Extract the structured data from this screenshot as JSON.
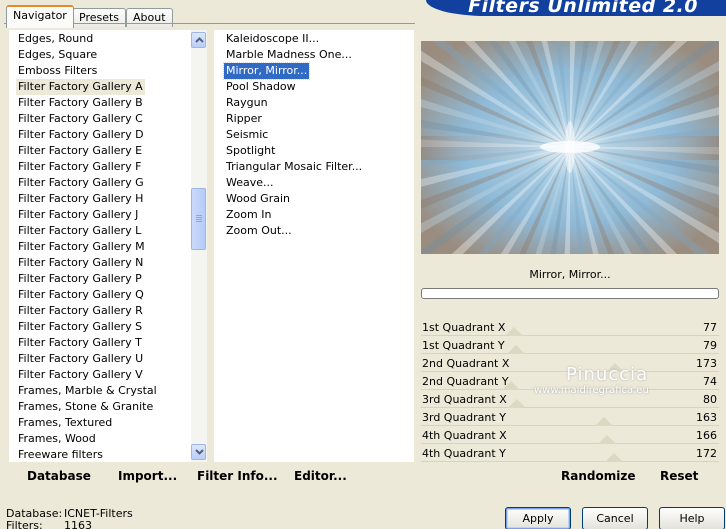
{
  "tabs": [
    {
      "label": "Navigator",
      "active": true
    },
    {
      "label": "Presets",
      "active": false
    },
    {
      "label": "About",
      "active": false
    }
  ],
  "banner_title": "Filters Unlimited 2.0",
  "categories": [
    "Edges, Round",
    "Edges, Square",
    "Emboss Filters",
    "Filter Factory Gallery A",
    "Filter Factory Gallery B",
    "Filter Factory Gallery C",
    "Filter Factory Gallery D",
    "Filter Factory Gallery E",
    "Filter Factory Gallery F",
    "Filter Factory Gallery G",
    "Filter Factory Gallery H",
    "Filter Factory Gallery J",
    "Filter Factory Gallery L",
    "Filter Factory Gallery M",
    "Filter Factory Gallery N",
    "Filter Factory Gallery P",
    "Filter Factory Gallery Q",
    "Filter Factory Gallery R",
    "Filter Factory Gallery S",
    "Filter Factory Gallery T",
    "Filter Factory Gallery U",
    "Filter Factory Gallery V",
    "Frames, Marble & Crystal",
    "Frames, Stone & Granite",
    "Frames, Textured",
    "Frames, Wood",
    "Freeware filters"
  ],
  "selected_category": "Filter Factory Gallery A",
  "filters": [
    "Kaleidoscope II...",
    "Marble Madness One...",
    "Mirror, Mirror...",
    "Pool Shadow",
    "Raygun",
    "Ripper",
    "Seismic",
    "Spotlight",
    "Triangular Mosaic Filter...",
    "Weave...",
    "Wood Grain",
    "Zoom In",
    "Zoom Out..."
  ],
  "selected_filter": "Mirror, Mirror...",
  "toolbar": {
    "database": "Database",
    "import": "Import...",
    "filter_info": "Filter Info...",
    "editor": "Editor..."
  },
  "filter_title": "Mirror, Mirror...",
  "sliders": [
    {
      "label": "1st Quadrant X",
      "value": 77
    },
    {
      "label": "1st Quadrant Y",
      "value": 79
    },
    {
      "label": "2nd Quadrant X",
      "value": 173
    },
    {
      "label": "2nd Quadrant Y",
      "value": 74
    },
    {
      "label": "3rd Quadrant X",
      "value": 80
    },
    {
      "label": "3rd Quadrant Y",
      "value": 163
    },
    {
      "label": "4th Quadrant X",
      "value": 166
    },
    {
      "label": "4th Quadrant Y",
      "value": 172
    }
  ],
  "slider_max": 255,
  "watermark": {
    "name": "Pinuccia",
    "url": "www.maidiregrafica.eu"
  },
  "randomize": "Randomize",
  "reset": "Reset",
  "status": {
    "database_label": "Database:",
    "database_value": "ICNET-Filters",
    "filters_label": "Filters:",
    "filters_value": "1163"
  },
  "buttons": {
    "apply": "Apply",
    "cancel": "Cancel",
    "help": "Help"
  },
  "colors": {
    "selection": "#316ac5",
    "banner": "#12409e",
    "tab_highlight": "#e68b2c"
  }
}
